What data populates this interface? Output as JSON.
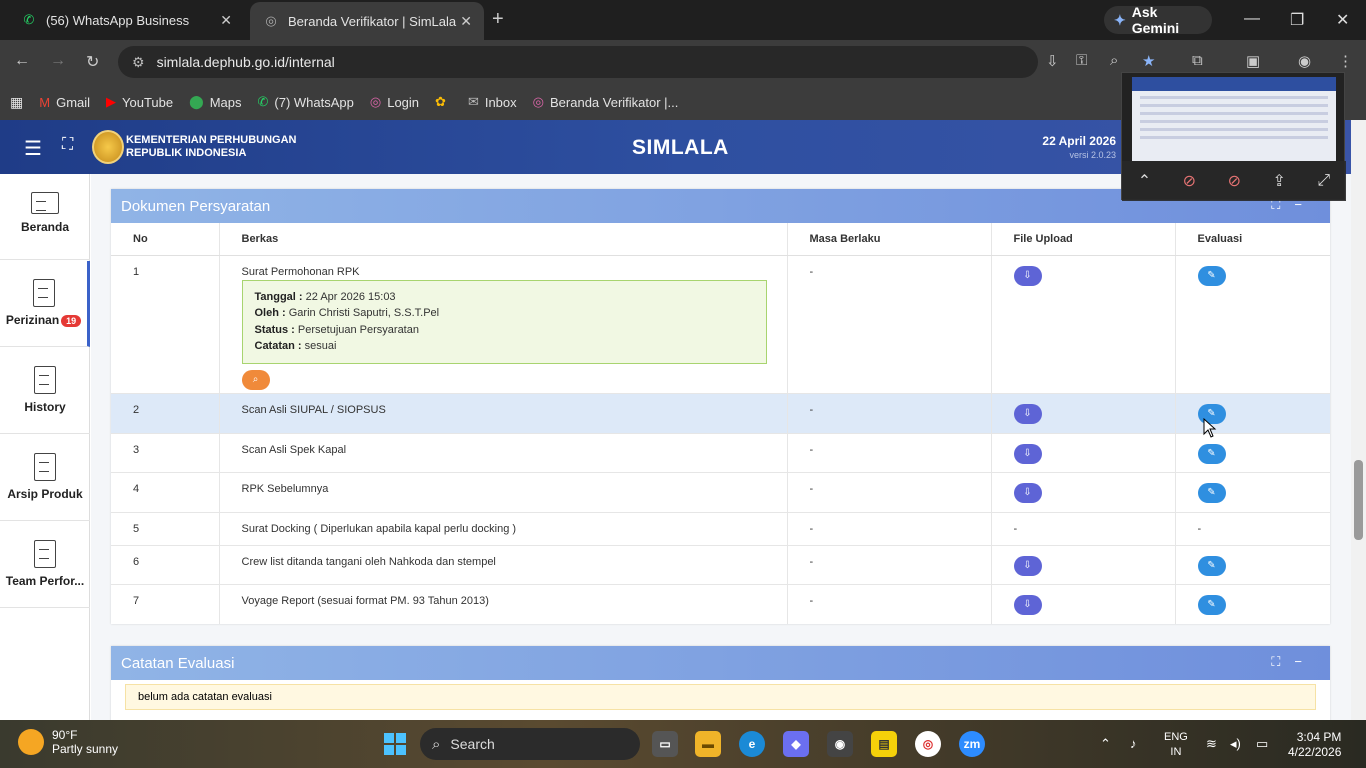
{
  "browser": {
    "tabs": [
      {
        "title": "(56) WhatsApp Business",
        "icon": "whatsapp-icon"
      },
      {
        "title": "Beranda Verifikator | SimLala",
        "icon": "globe-icon"
      }
    ],
    "gemini_label": "Ask Gemini",
    "url": "simlala.dephub.go.id/internal",
    "bookmarks": [
      {
        "label": "Gmail",
        "icon": "gmail-icon"
      },
      {
        "label": "YouTube",
        "icon": "youtube-icon"
      },
      {
        "label": "Maps",
        "icon": "maps-icon"
      },
      {
        "label": "(7) WhatsApp",
        "icon": "whatsapp-icon"
      },
      {
        "label": "Login",
        "icon": "globe-icon"
      },
      {
        "label": "",
        "icon": "photos-icon"
      },
      {
        "label": "Inbox",
        "icon": "mail-icon"
      },
      {
        "label": "Beranda Verifikator |...",
        "icon": "globe-icon"
      }
    ]
  },
  "header": {
    "org_line1": "KEMENTERIAN PERHUBUNGAN",
    "org_line2": "REPUBLIK INDONESIA",
    "brand": "SIMLALA",
    "date": "22 April 2026",
    "version": "versi 2.0.23"
  },
  "sidebar": {
    "items": [
      {
        "label": "Beranda",
        "badge": ""
      },
      {
        "label": "Perizinan",
        "badge": "19"
      },
      {
        "label": "History",
        "badge": ""
      },
      {
        "label": "Arsip Produk",
        "badge": ""
      },
      {
        "label": "Team Perfor...",
        "badge": ""
      }
    ]
  },
  "dokumen": {
    "title": "Dokumen Persyaratan",
    "columns": [
      "No",
      "Berkas",
      "Masa Berlaku",
      "File Upload",
      "Evaluasi"
    ],
    "detail": {
      "tanggal_label": "Tanggal :",
      "tanggal": "22 Apr 2026 15:03",
      "oleh_label": "Oleh :",
      "oleh": "Garin Christi Saputri, S.S.T.Pel",
      "status_label": "Status :",
      "status": "Persetujuan Persyaratan",
      "catatan_label": "Catatan :",
      "catatan": "sesuai"
    },
    "rows": [
      {
        "no": "1",
        "berkas": "Surat Permohonan RPK",
        "masa": "-",
        "upload": "button",
        "evaluasi": "button"
      },
      {
        "no": "2",
        "berkas": "Scan Asli SIUPAL / SIOPSUS",
        "masa": "-",
        "upload": "button",
        "evaluasi": "button"
      },
      {
        "no": "3",
        "berkas": "Scan Asli Spek Kapal",
        "masa": "-",
        "upload": "button",
        "evaluasi": "button"
      },
      {
        "no": "4",
        "berkas": "RPK Sebelumnya",
        "masa": "-",
        "upload": "button",
        "evaluasi": "button"
      },
      {
        "no": "5",
        "berkas": "Surat Docking ( Diperlukan apabila kapal perlu docking )",
        "masa": "-",
        "upload": "-",
        "evaluasi": "-"
      },
      {
        "no": "6",
        "berkas": "Crew list ditanda tangani oleh Nahkoda dan stempel",
        "masa": "-",
        "upload": "button",
        "evaluasi": "button"
      },
      {
        "no": "7",
        "berkas": "Voyage Report (sesuai format PM. 93 Tahun 2013)",
        "masa": "-",
        "upload": "button",
        "evaluasi": "button"
      }
    ]
  },
  "catatan": {
    "title": "Catatan Evaluasi",
    "empty_text": "belum ada catatan evaluasi"
  },
  "taskbar": {
    "temp": "90°F",
    "weather": "Partly sunny",
    "search_placeholder": "Search",
    "lang_line1": "ENG",
    "lang_line2": "IN",
    "time": "3:04 PM",
    "date": "4/22/2026"
  }
}
